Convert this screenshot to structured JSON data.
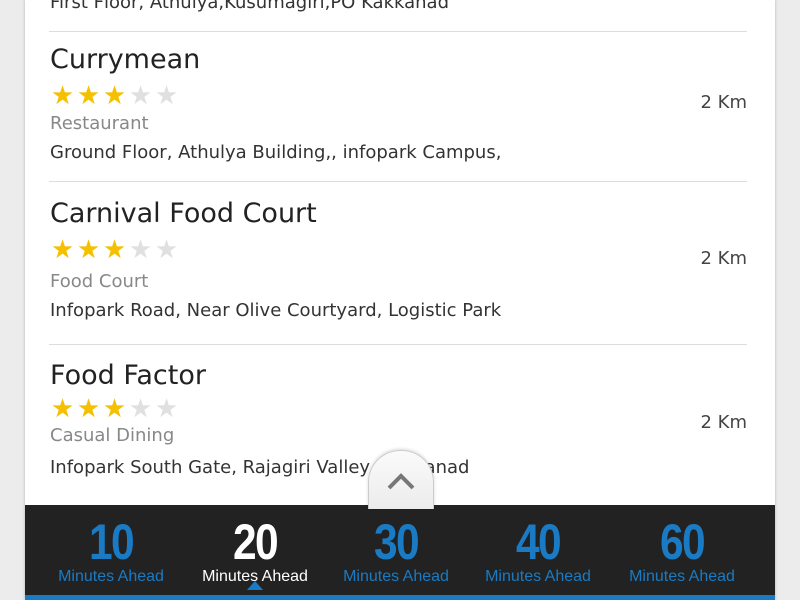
{
  "colors": {
    "accent": "#1a7bc4",
    "star_filled": "#f5c000",
    "star_empty": "#e0e0e0",
    "bar_bg": "#222222"
  },
  "partial_address": "First Floor, Athulya,Kusumagiri,PO Kakkanad",
  "places": [
    {
      "name": "Currymean",
      "rating": 3,
      "max_rating": 5,
      "category": "Restaurant",
      "address": "Ground Floor, Athulya Building,, infopark Campus,",
      "distance": "2 Km"
    },
    {
      "name": "Carnival Food Court",
      "rating": 3,
      "max_rating": 5,
      "category": "Food Court",
      "address": "Infopark Road, Near Olive Courtyard, Logistic Park",
      "distance": "2 Km"
    },
    {
      "name": "Food Factor",
      "rating": 3,
      "max_rating": 5,
      "category": "Casual Dining",
      "address": "Infopark South Gate, Rajagiri Valley, Kakkanad",
      "distance": "2 Km"
    }
  ],
  "expand_icon": "chevron-up-icon",
  "time_tabs": [
    {
      "value": "10",
      "label": "Minutes Ahead",
      "selected": false
    },
    {
      "value": "20",
      "label": "Minutes Ahead",
      "selected": true
    },
    {
      "value": "30",
      "label": "Minutes Ahead",
      "selected": false
    },
    {
      "value": "40",
      "label": "Minutes Ahead",
      "selected": false
    },
    {
      "value": "60",
      "label": "Minutes Ahead",
      "selected": false
    }
  ]
}
